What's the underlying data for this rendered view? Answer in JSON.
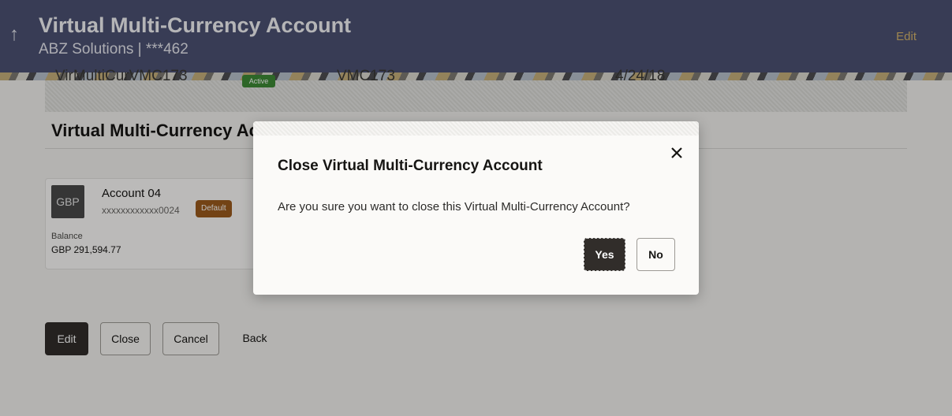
{
  "header": {
    "title": "Virtual Multi-Currency Account",
    "subtitle": "ABZ Solutions | ***462",
    "edit_label": "Edit",
    "back_icon": "up-arrow-icon"
  },
  "summary_row": {
    "name": "VirMultiCurVMC173",
    "status": "Active",
    "code": "VMC173",
    "date": "4/24/18"
  },
  "section": {
    "title": "Virtual Multi-Currency Account"
  },
  "account_card": {
    "currency_tile": "GBP",
    "name": "Account 04",
    "number": "xxxxxxxxxxxx0024",
    "default_badge": "Default",
    "balance_label": "Balance",
    "balance_value": "GBP 291,594.77"
  },
  "actions": {
    "edit": "Edit",
    "close": "Close",
    "cancel": "Cancel",
    "back": "Back"
  },
  "dialog": {
    "title": "Close Virtual Multi-Currency Account",
    "message": "Are you sure you want to close this Virtual Multi-Currency Account?",
    "yes": "Yes",
    "no": "No",
    "close_icon": "close-icon"
  },
  "colors": {
    "header_bg": "#4c5273",
    "accent_gold": "#d5b46b",
    "primary_button": "#312d2a",
    "active_badge": "#3d8a35",
    "default_badge": "#9b5b1d"
  }
}
